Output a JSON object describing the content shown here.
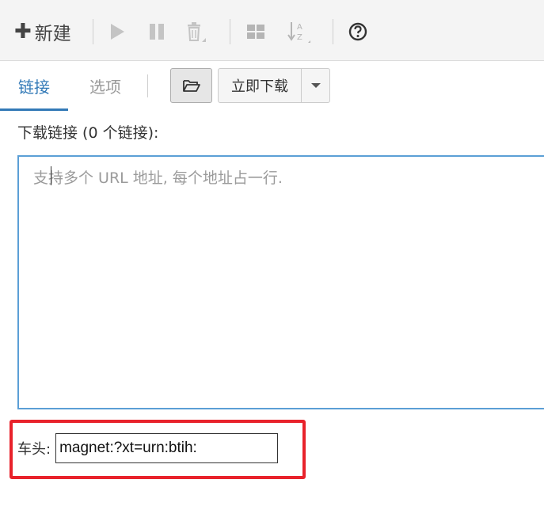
{
  "toolbar": {
    "new_label": "新建"
  },
  "tabs": {
    "links": "链接",
    "options": "选项"
  },
  "actions": {
    "download_now": "立即下载"
  },
  "links_label": "下载链接 (0 个链接):",
  "urls": {
    "placeholder": "支持多个 URL 地址, 每个地址占一行."
  },
  "header_field": {
    "label": "车头:",
    "value": "magnet:?xt=urn:btih:"
  },
  "colors": {
    "accent": "#337ab7",
    "highlight": "#e8222b",
    "focus_border": "#5b9fd6"
  }
}
